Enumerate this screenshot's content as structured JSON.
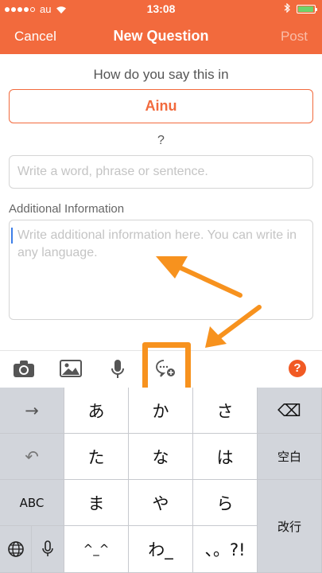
{
  "status_bar": {
    "carrier": "au",
    "time": "13:08",
    "signal_bars": 4,
    "battery_level": 0.95
  },
  "nav": {
    "cancel": "Cancel",
    "title": "New Question",
    "post": "Post"
  },
  "form": {
    "prompt": "How do you say this in",
    "language": "Ainu",
    "question_mark": "?",
    "word_placeholder": "Write a word, phrase or sentence.",
    "additional_label": "Additional Information",
    "additional_placeholder": "Write additional information here. You can write in any language."
  },
  "toolbar": {
    "icons": [
      "camera-icon",
      "image-icon",
      "microphone-icon",
      "sticker-icon",
      "help-icon"
    ],
    "help_label": "?"
  },
  "keyboard": {
    "keys": {
      "next": "→",
      "a": "あ",
      "ka": "か",
      "sa": "さ",
      "delete": "⌫",
      "undo": "↶",
      "ta": "た",
      "na": "な",
      "ha": "は",
      "space": "空白",
      "abc": "ABC",
      "ma": "ま",
      "ya": "や",
      "ra": "ら",
      "enter": "改行",
      "globe": "globe-icon",
      "mic": "microphone-icon",
      "emoticon": "^_^",
      "wa": "わ_",
      "punct": "、。?!"
    }
  },
  "colors": {
    "brand": "#f26a3d",
    "highlight": "#f7921e",
    "help": "#f15a24"
  }
}
